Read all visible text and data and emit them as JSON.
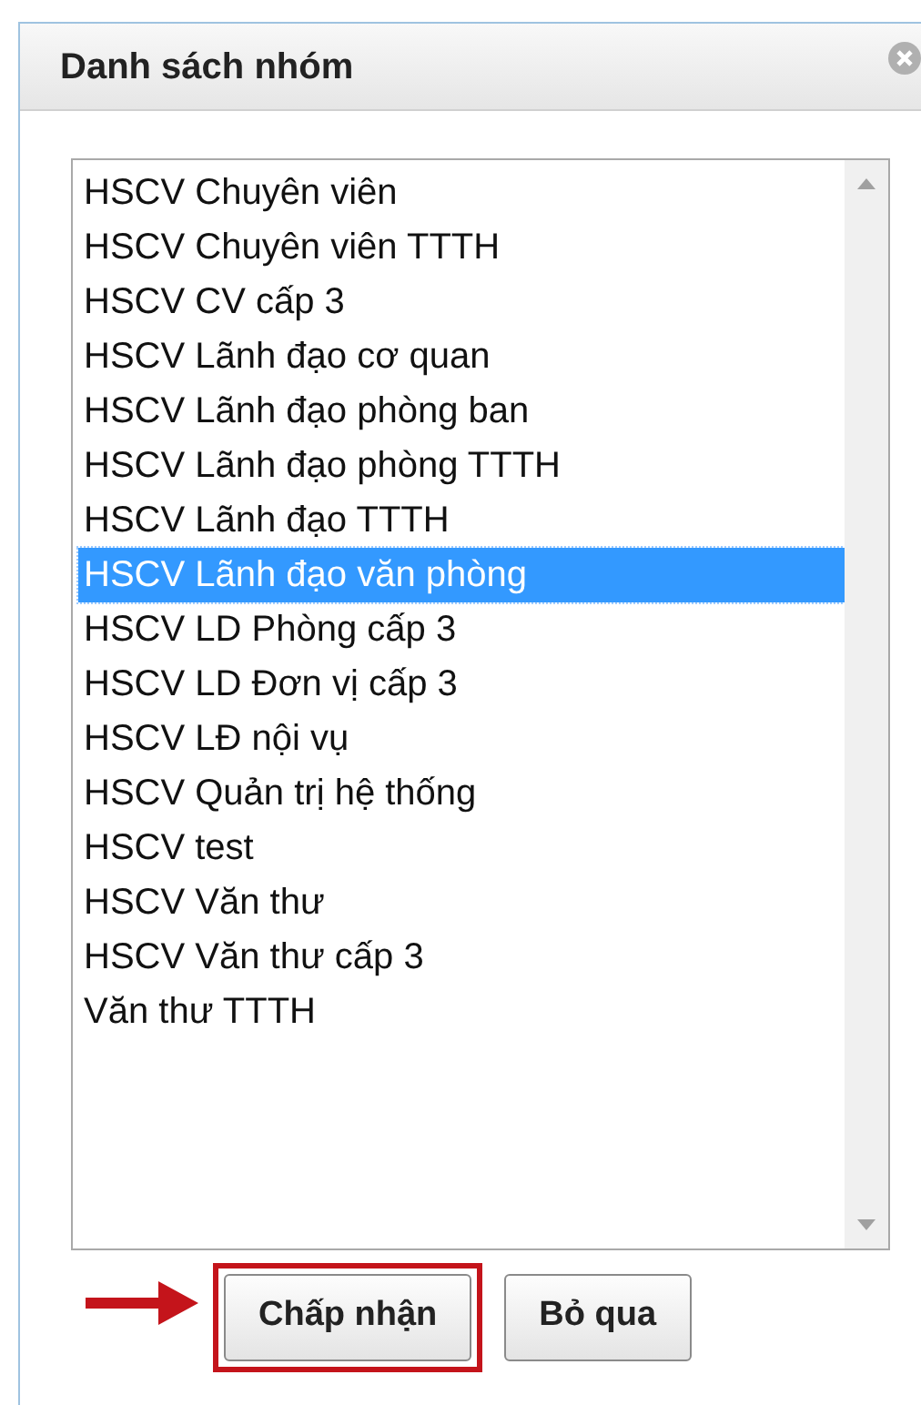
{
  "dialog": {
    "title": "Danh sách nhóm"
  },
  "list": {
    "items": [
      {
        "label": "HSCV Chuyên viên",
        "selected": false
      },
      {
        "label": "HSCV Chuyên viên TTTH",
        "selected": false
      },
      {
        "label": "HSCV CV cấp 3",
        "selected": false
      },
      {
        "label": "HSCV Lãnh đạo cơ quan",
        "selected": false
      },
      {
        "label": "HSCV Lãnh đạo phòng ban",
        "selected": false
      },
      {
        "label": "HSCV Lãnh đạo phòng TTTH",
        "selected": false
      },
      {
        "label": "HSCV Lãnh đạo TTTH",
        "selected": false
      },
      {
        "label": "HSCV Lãnh đạo văn phòng",
        "selected": true
      },
      {
        "label": "HSCV LD Phòng cấp 3",
        "selected": false
      },
      {
        "label": "HSCV LD Đơn vị cấp 3",
        "selected": false
      },
      {
        "label": "HSCV LĐ nội vụ",
        "selected": false
      },
      {
        "label": "HSCV Quản trị hệ thống",
        "selected": false
      },
      {
        "label": "HSCV test",
        "selected": false
      },
      {
        "label": "HSCV Văn thư",
        "selected": false
      },
      {
        "label": "HSCV Văn thư cấp 3",
        "selected": false
      },
      {
        "label": "Văn thư TTTH",
        "selected": false
      }
    ]
  },
  "buttons": [
    {
      "label": "Chấp nhận",
      "highlighted": true
    },
    {
      "label": "Bỏ qua",
      "highlighted": false
    }
  ]
}
